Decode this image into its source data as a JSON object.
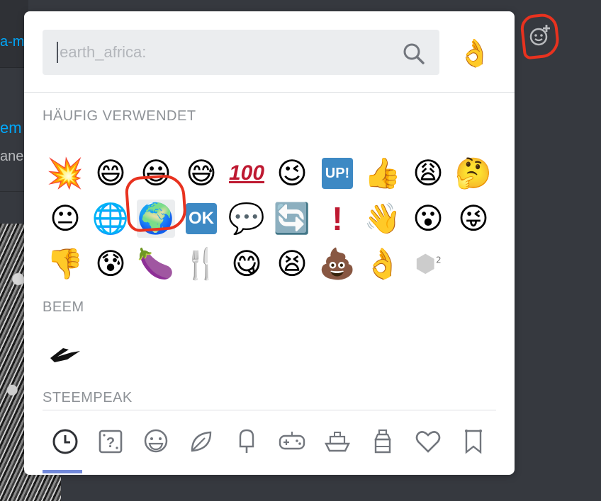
{
  "background": {
    "link_fragment": "a-m",
    "message_title_fragment": "em",
    "message_sub_fragment": "ane"
  },
  "search": {
    "value": "",
    "placeholder": ":earth_africa:"
  },
  "diversity_selector": {
    "glyph": "👌"
  },
  "categories": [
    {
      "title": "HÄUFIG VERWENDET",
      "emojis": [
        "💥",
        "😄",
        "😃",
        "😅",
        "💯",
        "😉",
        "🆙",
        "👍",
        "😩",
        "🤔",
        "😐",
        "🌐",
        "🌍",
        "🆗",
        "💬",
        "🔄",
        "❗",
        "👋",
        "😮",
        "😜",
        "👎",
        "😰",
        "🍆",
        "🍴",
        "😋",
        "😫",
        "💩",
        "👌",
        "SP²"
      ]
    },
    {
      "title": "BEEM",
      "emojis": [
        "beem-logo"
      ]
    },
    {
      "title": "STEEMPEAK",
      "emojis": []
    }
  ],
  "labels": {
    "hundred": "100",
    "up": "UP!",
    "ok": "OK",
    "excl": "!",
    "sp_sup": "2"
  },
  "selected_emoji": "earth-africa",
  "tabs": [
    "recent",
    "custom",
    "people",
    "nature",
    "food",
    "activity",
    "travel",
    "objects",
    "symbols",
    "flags"
  ],
  "active_tab": "recent",
  "colors": {
    "accent": "#7289da",
    "annotation": "#e8321f"
  }
}
